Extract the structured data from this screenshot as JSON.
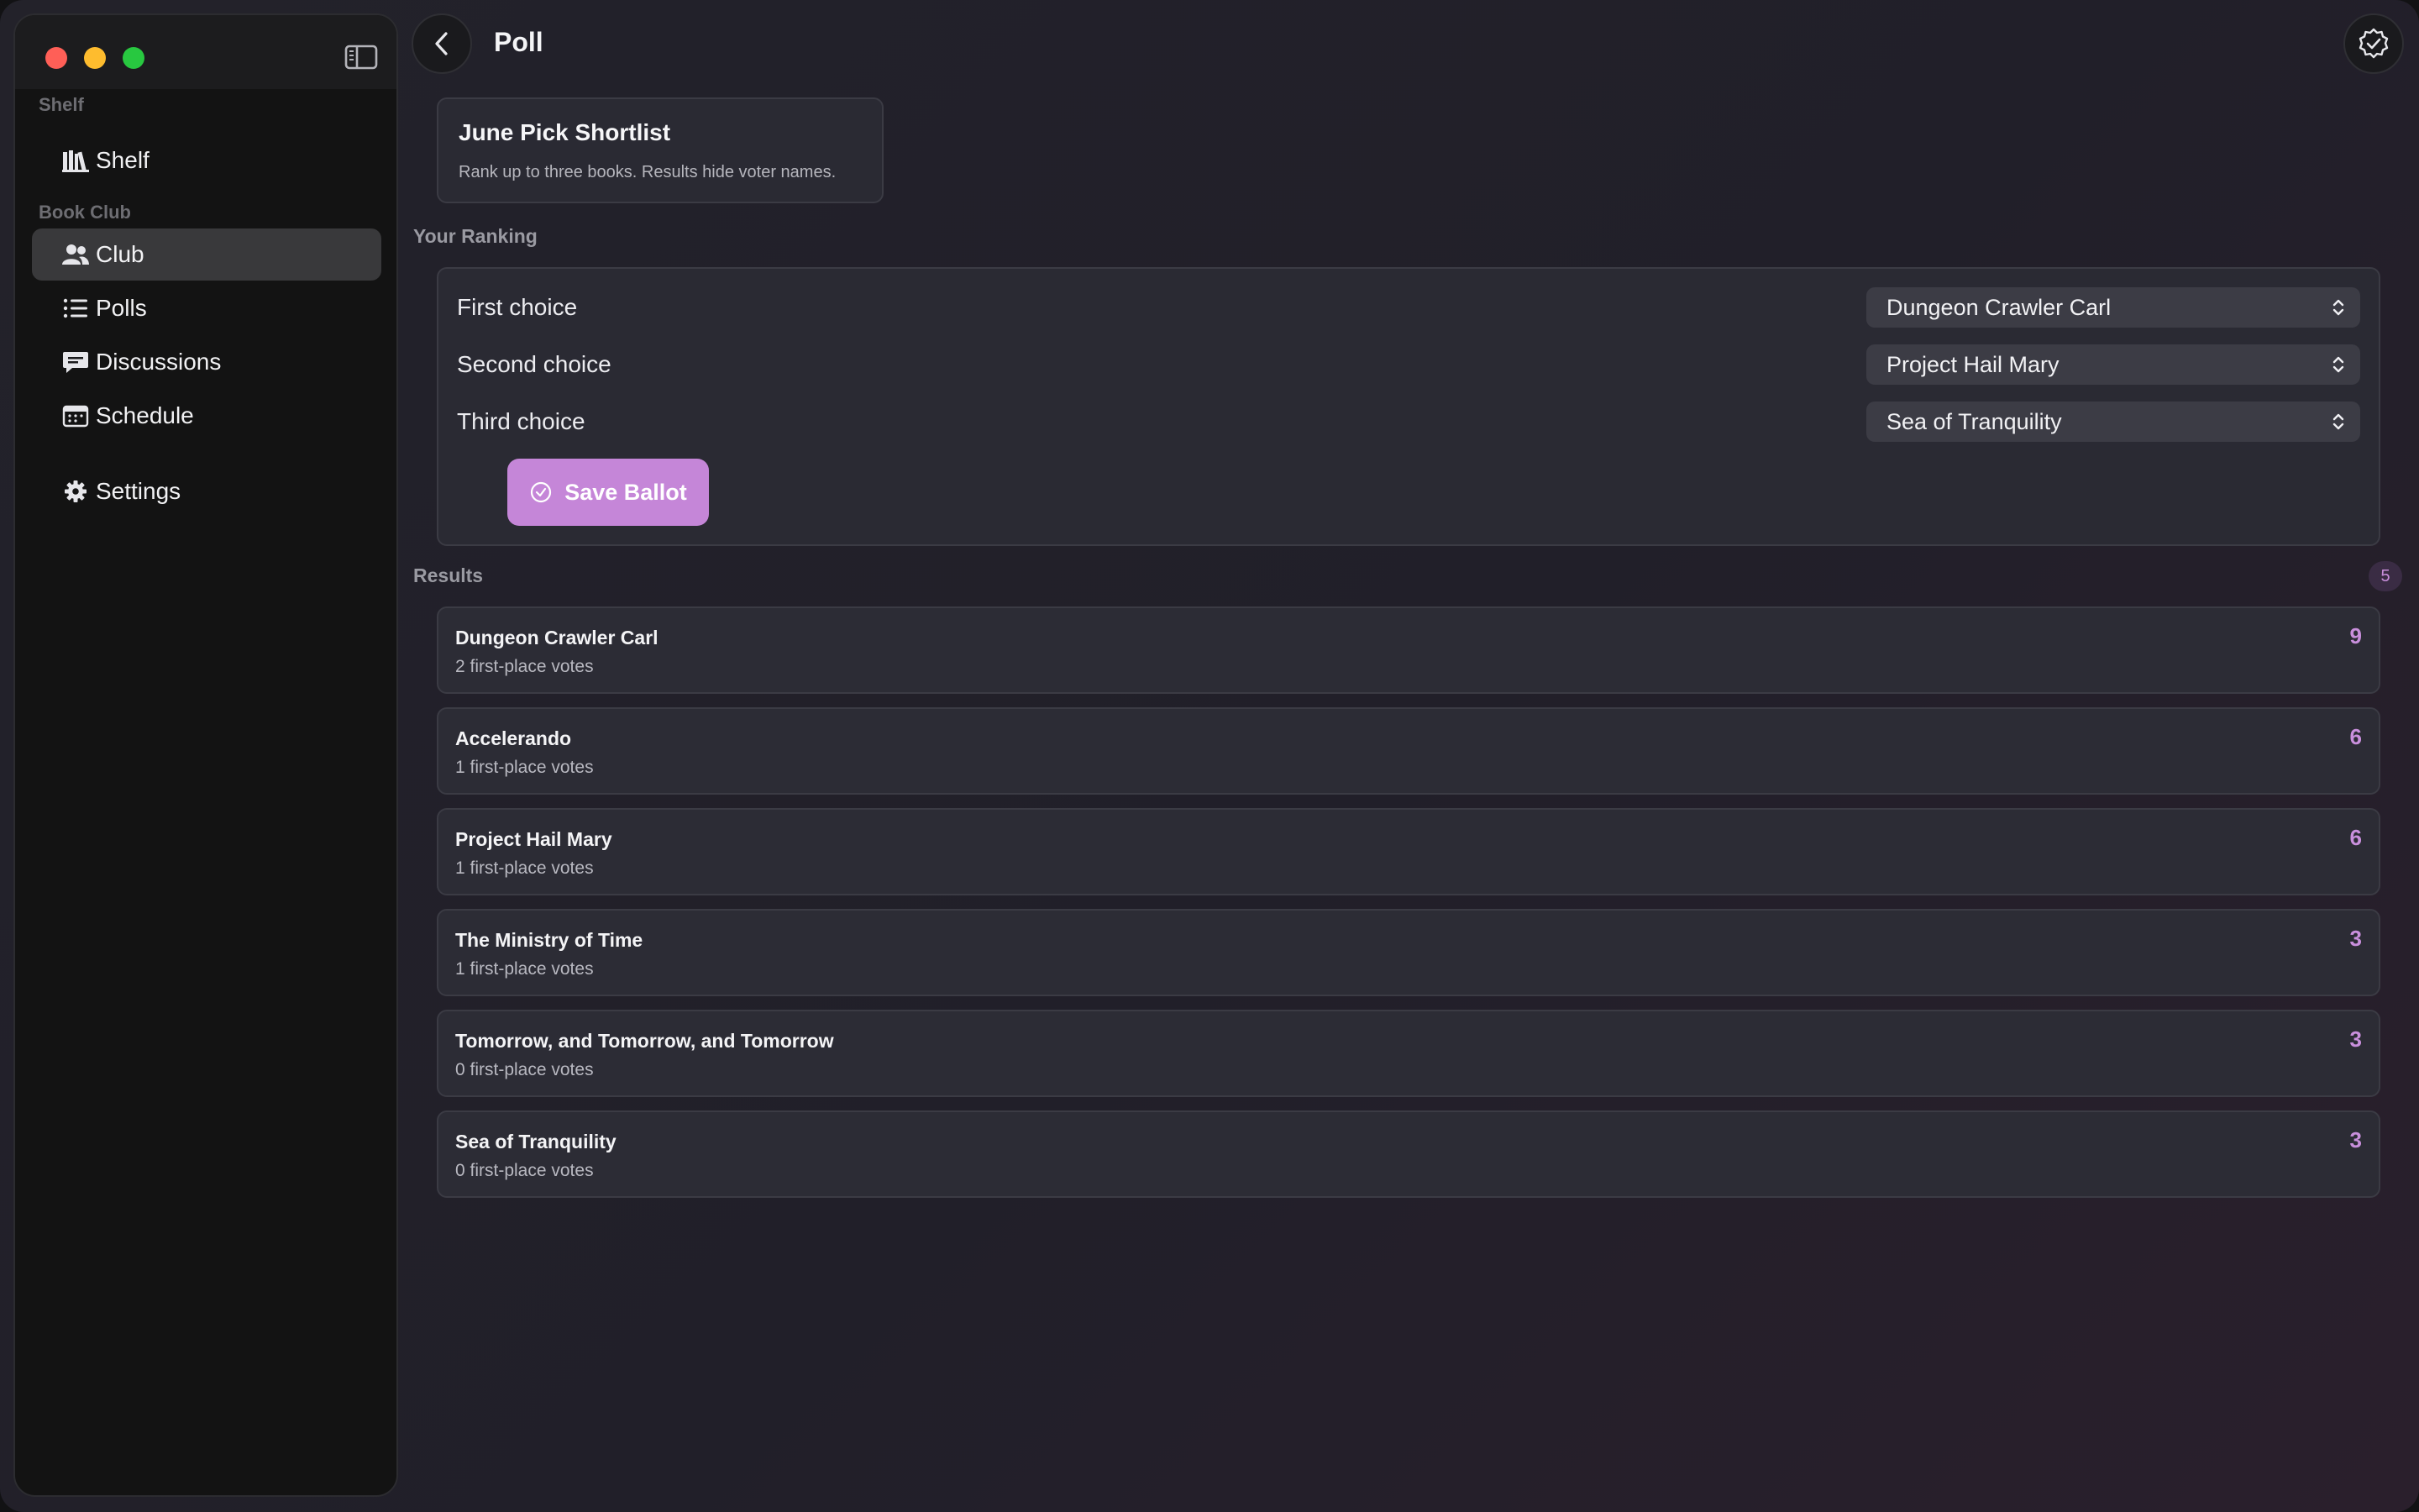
{
  "window": {
    "traffic_lights": [
      "close",
      "minimize",
      "zoom"
    ]
  },
  "sidebar": {
    "sections": [
      {
        "label": "Shelf",
        "items": [
          {
            "label": "Shelf",
            "icon": "books-icon"
          }
        ]
      },
      {
        "label": "Book Club",
        "items": [
          {
            "label": "Club",
            "icon": "people-icon",
            "active": true
          },
          {
            "label": "Polls",
            "icon": "list-icon"
          },
          {
            "label": "Discussions",
            "icon": "chat-bubble-icon"
          },
          {
            "label": "Schedule",
            "icon": "calendar-icon"
          }
        ]
      }
    ],
    "footer_item": {
      "label": "Settings",
      "icon": "gear-icon"
    }
  },
  "header": {
    "title": "Poll"
  },
  "poll": {
    "title": "June Pick Shortlist",
    "description": "Rank up to three books. Results hide voter names."
  },
  "ranking": {
    "label": "Your Ranking",
    "rows": [
      {
        "label": "First choice",
        "value": "Dungeon Crawler Carl"
      },
      {
        "label": "Second choice",
        "value": "Project Hail Mary"
      },
      {
        "label": "Third choice",
        "value": "Sea of Tranquility"
      }
    ],
    "save_label": "Save Ballot"
  },
  "results": {
    "label": "Results",
    "count": "5",
    "items": [
      {
        "title": "Dungeon Crawler Carl",
        "subtitle": "2 first-place votes",
        "score": "9"
      },
      {
        "title": "Accelerando",
        "subtitle": "1 first-place votes",
        "score": "6"
      },
      {
        "title": "Project Hail Mary",
        "subtitle": "1 first-place votes",
        "score": "6"
      },
      {
        "title": "The Ministry of Time",
        "subtitle": "1 first-place votes",
        "score": "3"
      },
      {
        "title": "Tomorrow, and Tomorrow, and Tomorrow",
        "subtitle": "0 first-place votes",
        "score": "3"
      },
      {
        "title": "Sea of Tranquility",
        "subtitle": "0 first-place votes",
        "score": "3"
      }
    ]
  },
  "colors": {
    "accent": "#c586d8",
    "score": "#c98fdc",
    "close": "#ff5f57",
    "minimize": "#febc2e",
    "zoom": "#28c840"
  }
}
